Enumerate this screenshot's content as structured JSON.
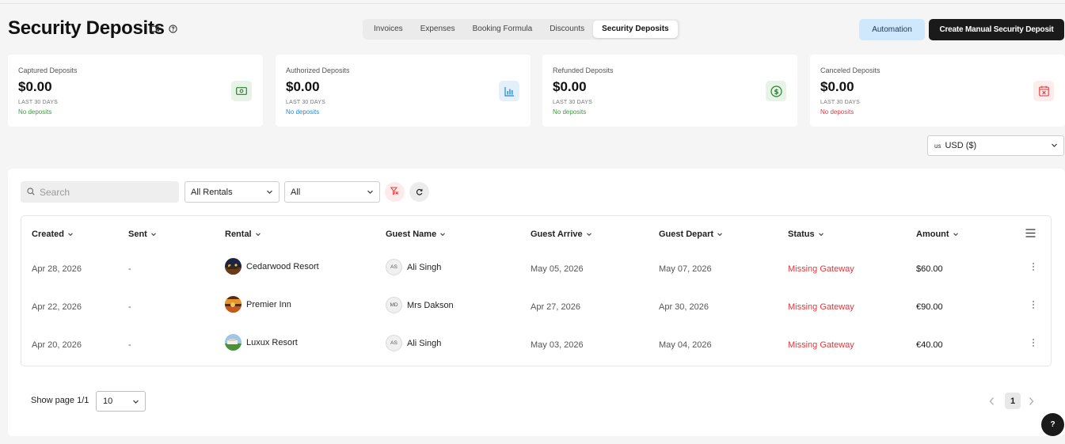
{
  "header": {
    "title": "Security Deposits",
    "tabs": [
      "Invoices",
      "Expenses",
      "Booking Formula",
      "Discounts",
      "Security Deposits"
    ],
    "active_tab": "Security Deposits",
    "automation_label": "Automation",
    "create_label": "Create Manual Security Deposit"
  },
  "cards": [
    {
      "label": "Captured Deposits",
      "amount": "$0.00",
      "period": "LAST 30 DAYS",
      "note": "No deposits",
      "note_color": "#3a9a3a",
      "icon": "money-icon"
    },
    {
      "label": "Authorized Deposits",
      "amount": "$0.00",
      "period": "LAST 30 DAYS",
      "note": "No deposits",
      "note_color": "#1e88d8",
      "icon": "bar-chart-icon"
    },
    {
      "label": "Refunded Deposits",
      "amount": "$0.00",
      "period": "LAST 30 DAYS",
      "note": "No deposits",
      "note_color": "#3a9a3a",
      "icon": "dollar-circle-icon"
    },
    {
      "label": "Canceled Deposits",
      "amount": "$0.00",
      "period": "LAST 30 DAYS",
      "note": "No deposits",
      "note_color": "#e0393e",
      "icon": "calendar-x-icon"
    }
  ],
  "currency": {
    "flag": "us",
    "value": "USD ($)"
  },
  "filters": {
    "search_placeholder": "Search",
    "rental_value": "All Rentals",
    "status_value": "All"
  },
  "table": {
    "columns": [
      "Created",
      "Sent",
      "Rental",
      "Guest Name",
      "Guest Arrive",
      "Guest Depart",
      "Status",
      "Amount"
    ],
    "rows": [
      {
        "created": "Apr 28, 2026",
        "sent": "-",
        "rental": "Cedarwood Resort",
        "initials": "AS",
        "guest": "Ali Singh",
        "arrive": "May 05, 2026",
        "depart": "May 07, 2026",
        "status": "Missing Gateway",
        "amount": "$60.00"
      },
      {
        "created": "Apr 22, 2026",
        "sent": "-",
        "rental": "Premier Inn",
        "initials": "MD",
        "guest": "Mrs Dakson",
        "arrive": "Apr 27, 2026",
        "depart": "Apr 30, 2026",
        "status": "Missing Gateway",
        "amount": "€90.00"
      },
      {
        "created": "Apr 20, 2026",
        "sent": "-",
        "rental": "Luxux Resort",
        "initials": "AS",
        "guest": "Ali Singh",
        "arrive": "May 03, 2026",
        "depart": "May 04, 2026",
        "status": "Missing Gateway",
        "amount": "€40.00"
      }
    ]
  },
  "pagination": {
    "label": "Show page 1/1",
    "page_size": "10",
    "current_page": "1"
  },
  "help_label": "?"
}
